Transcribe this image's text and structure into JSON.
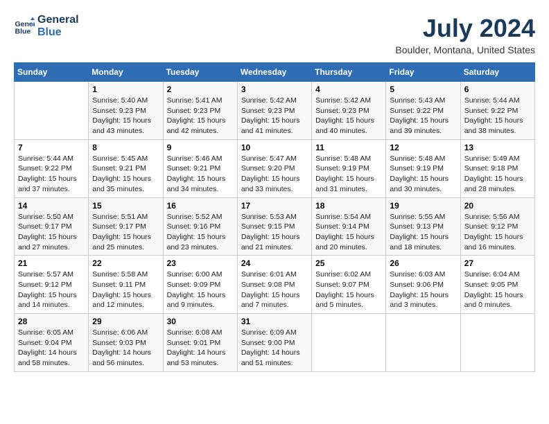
{
  "header": {
    "logo_line1": "General",
    "logo_line2": "Blue",
    "month_year": "July 2024",
    "location": "Boulder, Montana, United States"
  },
  "days_of_week": [
    "Sunday",
    "Monday",
    "Tuesday",
    "Wednesday",
    "Thursday",
    "Friday",
    "Saturday"
  ],
  "weeks": [
    [
      {
        "day": "",
        "info": ""
      },
      {
        "day": "1",
        "info": "Sunrise: 5:40 AM\nSunset: 9:23 PM\nDaylight: 15 hours\nand 43 minutes."
      },
      {
        "day": "2",
        "info": "Sunrise: 5:41 AM\nSunset: 9:23 PM\nDaylight: 15 hours\nand 42 minutes."
      },
      {
        "day": "3",
        "info": "Sunrise: 5:42 AM\nSunset: 9:23 PM\nDaylight: 15 hours\nand 41 minutes."
      },
      {
        "day": "4",
        "info": "Sunrise: 5:42 AM\nSunset: 9:23 PM\nDaylight: 15 hours\nand 40 minutes."
      },
      {
        "day": "5",
        "info": "Sunrise: 5:43 AM\nSunset: 9:22 PM\nDaylight: 15 hours\nand 39 minutes."
      },
      {
        "day": "6",
        "info": "Sunrise: 5:44 AM\nSunset: 9:22 PM\nDaylight: 15 hours\nand 38 minutes."
      }
    ],
    [
      {
        "day": "7",
        "info": "Sunrise: 5:44 AM\nSunset: 9:22 PM\nDaylight: 15 hours\nand 37 minutes."
      },
      {
        "day": "8",
        "info": "Sunrise: 5:45 AM\nSunset: 9:21 PM\nDaylight: 15 hours\nand 35 minutes."
      },
      {
        "day": "9",
        "info": "Sunrise: 5:46 AM\nSunset: 9:21 PM\nDaylight: 15 hours\nand 34 minutes."
      },
      {
        "day": "10",
        "info": "Sunrise: 5:47 AM\nSunset: 9:20 PM\nDaylight: 15 hours\nand 33 minutes."
      },
      {
        "day": "11",
        "info": "Sunrise: 5:48 AM\nSunset: 9:19 PM\nDaylight: 15 hours\nand 31 minutes."
      },
      {
        "day": "12",
        "info": "Sunrise: 5:48 AM\nSunset: 9:19 PM\nDaylight: 15 hours\nand 30 minutes."
      },
      {
        "day": "13",
        "info": "Sunrise: 5:49 AM\nSunset: 9:18 PM\nDaylight: 15 hours\nand 28 minutes."
      }
    ],
    [
      {
        "day": "14",
        "info": "Sunrise: 5:50 AM\nSunset: 9:17 PM\nDaylight: 15 hours\nand 27 minutes."
      },
      {
        "day": "15",
        "info": "Sunrise: 5:51 AM\nSunset: 9:17 PM\nDaylight: 15 hours\nand 25 minutes."
      },
      {
        "day": "16",
        "info": "Sunrise: 5:52 AM\nSunset: 9:16 PM\nDaylight: 15 hours\nand 23 minutes."
      },
      {
        "day": "17",
        "info": "Sunrise: 5:53 AM\nSunset: 9:15 PM\nDaylight: 15 hours\nand 21 minutes."
      },
      {
        "day": "18",
        "info": "Sunrise: 5:54 AM\nSunset: 9:14 PM\nDaylight: 15 hours\nand 20 minutes."
      },
      {
        "day": "19",
        "info": "Sunrise: 5:55 AM\nSunset: 9:13 PM\nDaylight: 15 hours\nand 18 minutes."
      },
      {
        "day": "20",
        "info": "Sunrise: 5:56 AM\nSunset: 9:12 PM\nDaylight: 15 hours\nand 16 minutes."
      }
    ],
    [
      {
        "day": "21",
        "info": "Sunrise: 5:57 AM\nSunset: 9:12 PM\nDaylight: 15 hours\nand 14 minutes."
      },
      {
        "day": "22",
        "info": "Sunrise: 5:58 AM\nSunset: 9:11 PM\nDaylight: 15 hours\nand 12 minutes."
      },
      {
        "day": "23",
        "info": "Sunrise: 6:00 AM\nSunset: 9:09 PM\nDaylight: 15 hours\nand 9 minutes."
      },
      {
        "day": "24",
        "info": "Sunrise: 6:01 AM\nSunset: 9:08 PM\nDaylight: 15 hours\nand 7 minutes."
      },
      {
        "day": "25",
        "info": "Sunrise: 6:02 AM\nSunset: 9:07 PM\nDaylight: 15 hours\nand 5 minutes."
      },
      {
        "day": "26",
        "info": "Sunrise: 6:03 AM\nSunset: 9:06 PM\nDaylight: 15 hours\nand 3 minutes."
      },
      {
        "day": "27",
        "info": "Sunrise: 6:04 AM\nSunset: 9:05 PM\nDaylight: 15 hours\nand 0 minutes."
      }
    ],
    [
      {
        "day": "28",
        "info": "Sunrise: 6:05 AM\nSunset: 9:04 PM\nDaylight: 14 hours\nand 58 minutes."
      },
      {
        "day": "29",
        "info": "Sunrise: 6:06 AM\nSunset: 9:03 PM\nDaylight: 14 hours\nand 56 minutes."
      },
      {
        "day": "30",
        "info": "Sunrise: 6:08 AM\nSunset: 9:01 PM\nDaylight: 14 hours\nand 53 minutes."
      },
      {
        "day": "31",
        "info": "Sunrise: 6:09 AM\nSunset: 9:00 PM\nDaylight: 14 hours\nand 51 minutes."
      },
      {
        "day": "",
        "info": ""
      },
      {
        "day": "",
        "info": ""
      },
      {
        "day": "",
        "info": ""
      }
    ]
  ]
}
